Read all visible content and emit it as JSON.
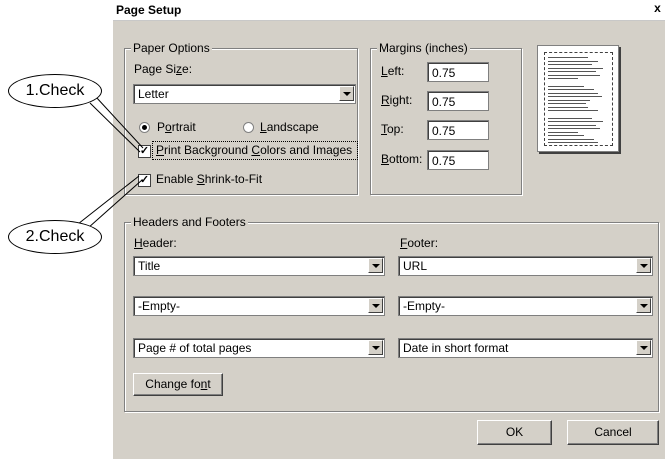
{
  "dialog": {
    "title": "Page Setup",
    "close_glyph": "x"
  },
  "paper_options": {
    "legend": "Paper Options",
    "size_label": "Page Size:",
    "size_value": "Letter",
    "portrait_label": "Portrait",
    "landscape_label": "Landscape",
    "orientation_selected": "Portrait",
    "print_bg_label": "Print Background Colors and Images",
    "print_bg_checked": true,
    "shrink_label": "Enable Shrink-to-Fit",
    "shrink_checked": true
  },
  "margins": {
    "legend": "Margins (inches)",
    "left_label": "Left:",
    "left_value": "0.75",
    "right_label": "Right:",
    "right_value": "0.75",
    "top_label": "Top:",
    "top_value": "0.75",
    "bottom_label": "Bottom:",
    "bottom_value": "0.75"
  },
  "headers_footers": {
    "legend": "Headers and Footers",
    "header_label": "Header:",
    "footer_label": "Footer:",
    "header_values": [
      "Title",
      "-Empty-",
      "Page # of total pages"
    ],
    "footer_values": [
      "URL",
      "-Empty-",
      "Date in short format"
    ],
    "change_font_label": "Change font"
  },
  "buttons": {
    "ok": "OK",
    "cancel": "Cancel"
  },
  "callouts": {
    "first": "1.Check",
    "second": "2.Check"
  }
}
